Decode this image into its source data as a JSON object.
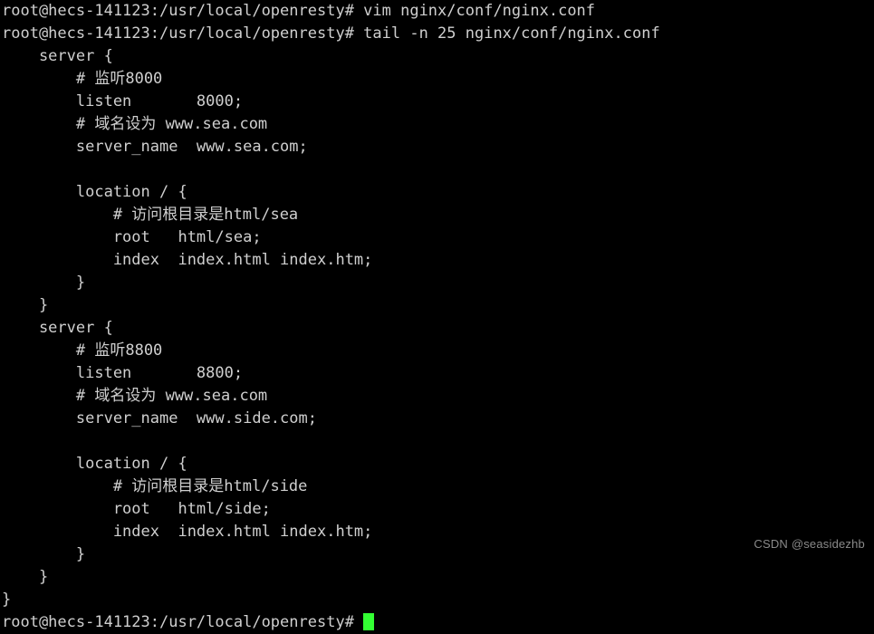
{
  "terminal": {
    "background_color": "#000000",
    "foreground_color": "#cfcfcf",
    "cursor_color": "#33ff33",
    "prompt": "root@hecs-141123:/usr/local/openresty#",
    "lines": [
      "root@hecs-141123:/usr/local/openresty# vim nginx/conf/nginx.conf",
      "root@hecs-141123:/usr/local/openresty# tail -n 25 nginx/conf/nginx.conf",
      "    server {",
      "        # 监听8000",
      "        listen       8000;",
      "        # 域名设为 www.sea.com",
      "        server_name  www.sea.com;",
      "",
      "        location / {",
      "            # 访问根目录是html/sea",
      "            root   html/sea;",
      "            index  index.html index.htm;",
      "        }",
      "    }",
      "    server {",
      "        # 监听8800",
      "        listen       8800;",
      "        # 域名设为 www.sea.com",
      "        server_name  www.side.com;",
      "",
      "        location / {",
      "            # 访问根目录是html/side",
      "            root   html/side;",
      "            index  index.html index.htm;",
      "        }",
      "    }",
      "}"
    ],
    "last_prompt_line": "root@hecs-141123:/usr/local/openresty# "
  },
  "watermark": {
    "text": "CSDN @seasidezhb"
  }
}
